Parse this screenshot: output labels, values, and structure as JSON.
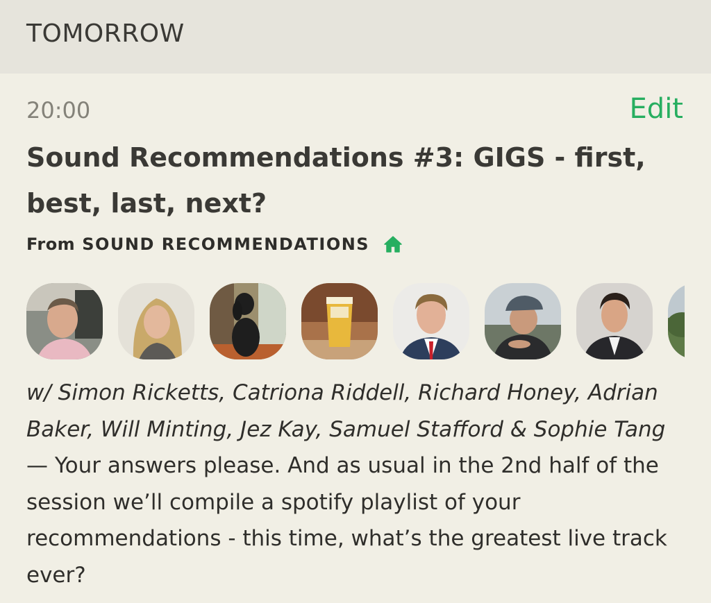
{
  "header": {
    "title": "TOMORROW"
  },
  "event": {
    "time": "20:00",
    "edit_label": "Edit",
    "title": "Sound Recommendations #3: GIGS - first, best, last, next?",
    "club_prefix": "From",
    "club_name": "SOUND RECOMMENDATIONS",
    "avatars": [
      {
        "name": "Simon Ricketts"
      },
      {
        "name": "Catriona Riddell"
      },
      {
        "name": "Richard Honey"
      },
      {
        "name": "Adrian Baker"
      },
      {
        "name": "Will Minting"
      },
      {
        "name": "Jez Kay"
      },
      {
        "name": "Samuel Stafford"
      },
      {
        "name": "Sophie Tang"
      }
    ],
    "speakers_text": "w/ Simon Ricketts, Catriona Riddell, Richard Honey, Adrian Baker, Will Minting, Jez Kay, Samuel Stafford & Sophie Tang",
    "description": " — Your answers please. And as usual in the 2nd half of the session we’ll compile a spotify playlist of your recommendations - this time, what’s the greatest live track ever?"
  },
  "colors": {
    "background": "#f1efe5",
    "header_bg": "#e6e4dc",
    "accent_green": "#27ae60",
    "muted_text": "#848279"
  }
}
